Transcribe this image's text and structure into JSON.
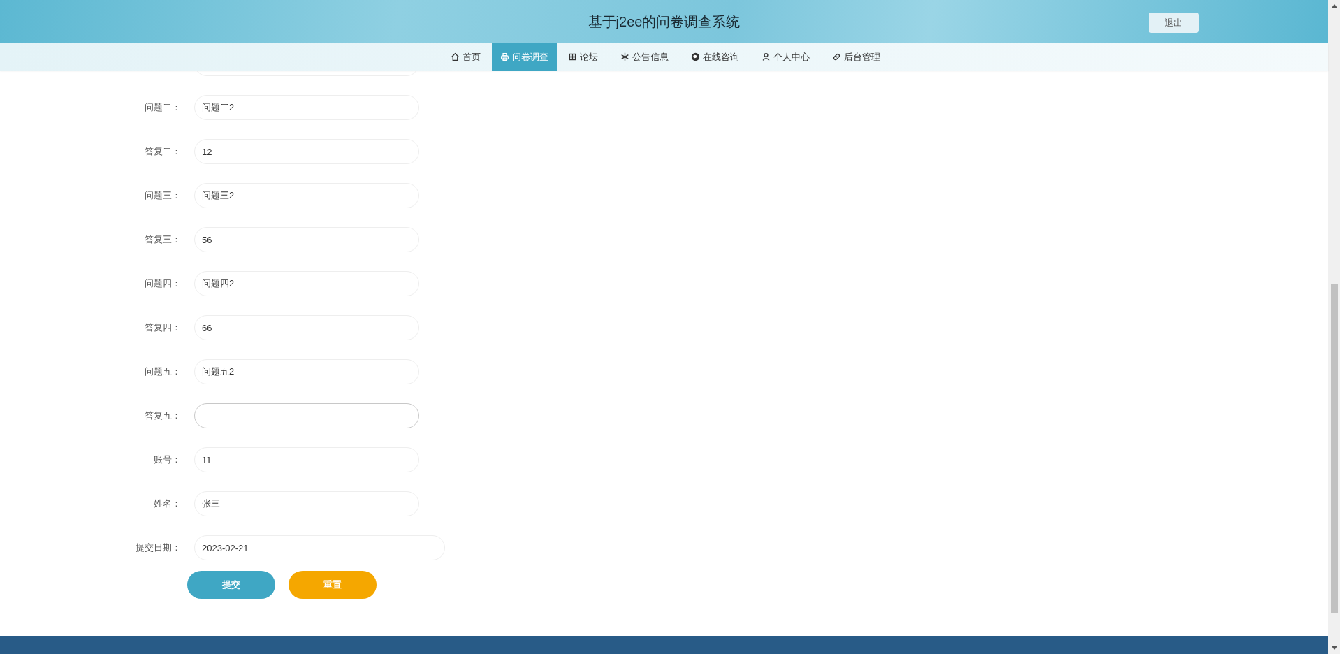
{
  "header": {
    "title": "基于j2ee的问卷调查系统",
    "logout": "退出"
  },
  "nav": [
    {
      "label": "首页",
      "selected": false
    },
    {
      "label": "问卷调查",
      "selected": true
    },
    {
      "label": "论坛",
      "selected": false
    },
    {
      "label": "公告信息",
      "selected": false
    },
    {
      "label": "在线咨询",
      "selected": false
    },
    {
      "label": "个人中心",
      "selected": false
    },
    {
      "label": "后台管理",
      "selected": false
    }
  ],
  "form": {
    "fields": [
      {
        "label": "问题二：",
        "value": "问题二2",
        "focused": false
      },
      {
        "label": "答复二：",
        "value": "12",
        "focused": false
      },
      {
        "label": "问题三：",
        "value": "问题三2",
        "focused": false
      },
      {
        "label": "答复三：",
        "value": "56",
        "focused": false
      },
      {
        "label": "问题四：",
        "value": "问题四2",
        "focused": false
      },
      {
        "label": "答复四：",
        "value": "66",
        "focused": false
      },
      {
        "label": "问题五：",
        "value": "问题五2",
        "focused": false
      },
      {
        "label": "答复五：",
        "focused": true
      },
      {
        "label": "账号：",
        "value": "11",
        "focused": false
      },
      {
        "label": "姓名：",
        "value": "张三",
        "focused": false
      },
      {
        "label": "提交日期：",
        "value": "2023-02-21",
        "focused": false,
        "kind": "wide"
      }
    ],
    "buttons": [
      {
        "label": "提交",
        "kind": "primary"
      },
      {
        "label": "重置",
        "kind": "secondary"
      }
    ]
  }
}
